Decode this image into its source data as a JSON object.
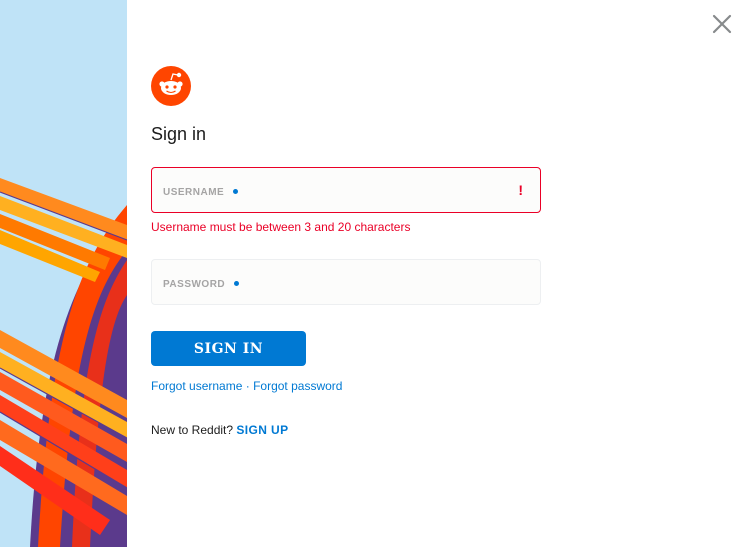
{
  "modal": {
    "title": "Sign in",
    "close_icon": "close-icon",
    "logo_icon": "reddit-snoo-logo",
    "accent_color": "#0079d3",
    "error_color": "#ea0027",
    "brand_color": "#ff4500"
  },
  "form": {
    "username": {
      "label": "USERNAME",
      "value": "",
      "error_icon": "!",
      "error_message": "Username must be between 3 and 20 characters"
    },
    "password": {
      "label": "PASSWORD",
      "value": ""
    },
    "submit_label": "SIGN IN"
  },
  "links": {
    "forgot_username": "Forgot username",
    "separator": "·",
    "forgot_password": "Forgot password",
    "new_prompt": "New to Reddit?",
    "signup": "SIGN UP"
  }
}
